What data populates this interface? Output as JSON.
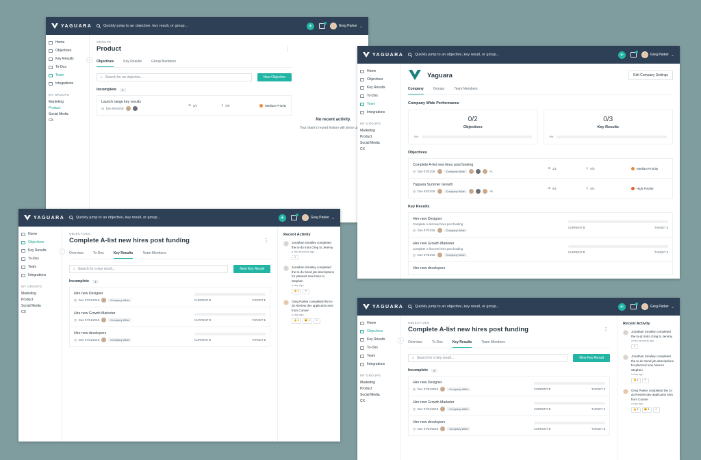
{
  "app": {
    "brand": "YAGUARA",
    "search_placeholder": "Quickly jump to an objective, key result, or group...",
    "user_name": "Greg Parker",
    "colors": {
      "topbar": "#2e4055",
      "accent": "#22b5a6",
      "background": "#7f9c9e"
    }
  },
  "nav": {
    "home": "Home",
    "objectives": "Objectives",
    "key_results": "Key Results",
    "todos": "To-Dos",
    "team": "Team",
    "integrations": "Integrations",
    "my_groups": "MY GROUPS",
    "groups": [
      "Marketing",
      "Product",
      "Social Media",
      "CX"
    ]
  },
  "group_page": {
    "crumb": "GROUPS",
    "title": "Product",
    "tabs": [
      "Objectives",
      "Key Results",
      "Group Members"
    ],
    "search_placeholder": "Search for an objective...",
    "new_button": "New Objective",
    "section": "Incomplete",
    "count": "1",
    "row": {
      "title": "Launch range key results",
      "due": "Due 06/18/18",
      "progress": "3/4",
      "krs": "0/0",
      "priority": "Medium Priority"
    },
    "empty_title": "No recent activity.",
    "empty_text": "Your team's recent history will show up here."
  },
  "company_page": {
    "title": "Yaguara",
    "edit_button": "Edit Company Settings",
    "tabs": [
      "Company",
      "Groups",
      "Team Members"
    ],
    "perf_title": "Company Wide Performance",
    "objectives_count": "0/2",
    "objectives_label": "Objectives",
    "objectives_pct": "0%",
    "krs_count": "0/3",
    "krs_label": "Key Results",
    "krs_pct": "0%",
    "objectives_title": "Objectives",
    "objectives": [
      {
        "title": "Complete A-list new hires post funding",
        "due": "Due 07/31/18",
        "tag": "Company Wide",
        "more": "+1",
        "progress": "1/1",
        "krs": "0/3",
        "priority": "Medium Priority"
      },
      {
        "title": "Yaguara Summer Growth",
        "due": "Due 03/12/18",
        "tag": "Company Wide",
        "more": "+5",
        "progress": "0/1",
        "krs": "0/2",
        "priority": "High Priority"
      }
    ],
    "krs_title": "Key Results",
    "key_results": [
      {
        "title": "Hire new Designer",
        "sub": "Complete A-list new hires post funding",
        "due": "Due 07/31/18",
        "tag": "Company Wide",
        "current": "0",
        "target": "1"
      },
      {
        "title": "Hire new Growth Marketer",
        "sub": "Complete A-list new hires post funding",
        "due": "Due 07/31/18",
        "tag": "Company Wide",
        "current": "0",
        "target": "1"
      },
      {
        "title": "Hire new developers"
      }
    ]
  },
  "objective_page": {
    "crumb": "OBJECTIVES",
    "title": "Complete A-list new hires post funding",
    "tabs": [
      "Overview",
      "To-Dos",
      "Key Results",
      "Team Members"
    ],
    "search_placeholder": "Search for a key result...",
    "new_button": "New Key Result",
    "section": "Incomplete",
    "count": "3",
    "current_label": "CURRENT",
    "target_label": "TARGET",
    "rows": [
      {
        "title": "Hire new Designer",
        "due": "Due 07/31/2018",
        "tag": "Company Wide",
        "current": "0",
        "target": "1"
      },
      {
        "title": "Hire new Growth Marketer",
        "due": "Due 07/31/2018",
        "tag": "Company Wide",
        "current": "0",
        "target": "1"
      },
      {
        "title": "Hire new developers",
        "due": "Due 07/31/2018",
        "tag": "Company Wide",
        "current": "0",
        "target": "2"
      }
    ],
    "activity_title": "Recent Activity",
    "activity": [
      {
        "text": "Jonathan Smalley completed the to-do Intro Greg to Jeremy",
        "ago": "a few seconds ago",
        "reacts": [
          "☺"
        ]
      },
      {
        "text": "Jonathan Smalley completed the to-do Send job descriptions for planned new hires to Stephen",
        "ago": "a day ago",
        "reacts": [
          "👍 1",
          "☺"
        ]
      },
      {
        "text": "Greg Parker completed the to-do Review dev applicants sent from Conner",
        "ago": "a day ago",
        "reacts": [
          "👍 1",
          "😮 1",
          "☺"
        ]
      }
    ]
  }
}
